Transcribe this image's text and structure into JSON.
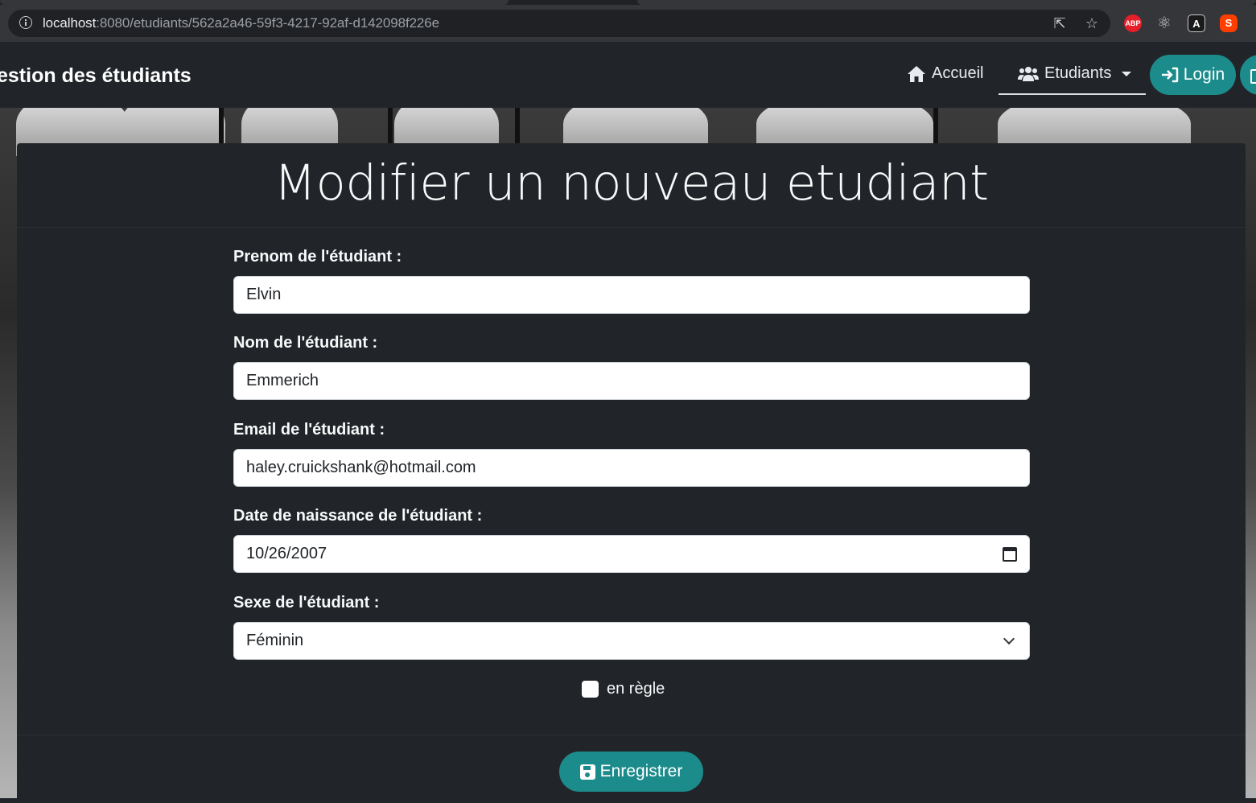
{
  "browser": {
    "url_host": "localhost",
    "url_path": ":8080/etudiants/562a2a46-59f3-4217-92af-d142098f226e",
    "extensions": [
      "adblock-icon",
      "react-devtools-icon",
      "angular-devtools-icon",
      "svelte-icon"
    ],
    "ext_abp_label": "ABP"
  },
  "navbar": {
    "brand": "estion des étudiants",
    "links": [
      {
        "label": "Accueil",
        "icon": "home-icon"
      },
      {
        "label": "Etudiants",
        "icon": "users-icon"
      }
    ],
    "login_label": "Login"
  },
  "form": {
    "title": "Modifier un nouveau etudiant",
    "fields": [
      {
        "label": "Prenom de l'étudiant :",
        "value": "Elvin"
      },
      {
        "label": "Nom de l'étudiant :",
        "value": "Emmerich"
      },
      {
        "label": "Email de l'étudiant :",
        "value": "haley.cruickshank@hotmail.com"
      },
      {
        "label": "Date de naissance de l'étudiant :",
        "value": "10/26/2007"
      },
      {
        "label": "Sexe de l'étudiant :",
        "value": "Féminin"
      }
    ],
    "checkbox_label": "en règle",
    "checkbox_checked": false,
    "save_label": "Enregistrer"
  },
  "colors": {
    "accent": "#1c8b8b",
    "background": "#212529"
  }
}
